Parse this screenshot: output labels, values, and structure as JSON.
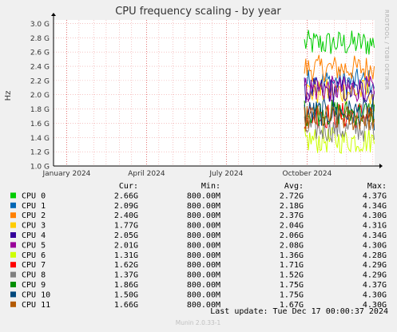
{
  "chart_data": {
    "type": "line",
    "title": "CPU frequency scaling - by year",
    "ylabel": "Hz",
    "watermark": "RRDTOOL / TOBI OETIKER",
    "ylim": [
      1.0,
      3.05
    ],
    "ytick_values": [
      1.0,
      1.2,
      1.4,
      1.6,
      1.8,
      2.0,
      2.2,
      2.4,
      2.6,
      2.8,
      3.0
    ],
    "ytick_labels": [
      "1.0 G",
      "1.2 G",
      "1.4 G",
      "1.6 G",
      "1.8 G",
      "2.0 G",
      "2.2 G",
      "2.4 G",
      "2.6 G",
      "2.8 G",
      "3.0 G"
    ],
    "xlim": [
      "2023-12-17",
      "2024-12-17"
    ],
    "xtick_labels": [
      "January 2024",
      "April 2024",
      "July 2024",
      "October 2024"
    ],
    "xtick_dates": [
      "2024-01-01",
      "2024-04-01",
      "2024-07-01",
      "2024-10-01"
    ],
    "data_start": "2024-09-28",
    "grid": true,
    "legend_header": {
      "cur": "Cur:",
      "min": "Min:",
      "avg": "Avg:",
      "max": "Max:"
    },
    "series": [
      {
        "name": "CPU 0",
        "color": "#00cc00",
        "cur": "2.66G",
        "min": "800.00M",
        "avg": "2.72G",
        "max": "4.37G"
      },
      {
        "name": "CPU 1",
        "color": "#0066b3",
        "cur": "2.09G",
        "min": "800.00M",
        "avg": "2.18G",
        "max": "4.34G"
      },
      {
        "name": "CPU 2",
        "color": "#ff8000",
        "cur": "2.40G",
        "min": "800.00M",
        "avg": "2.37G",
        "max": "4.30G"
      },
      {
        "name": "CPU 3",
        "color": "#ffcc00",
        "cur": "1.77G",
        "min": "800.00M",
        "avg": "2.04G",
        "max": "4.31G"
      },
      {
        "name": "CPU 4",
        "color": "#330099",
        "cur": "2.05G",
        "min": "800.00M",
        "avg": "2.06G",
        "max": "4.34G"
      },
      {
        "name": "CPU 5",
        "color": "#990099",
        "cur": "2.01G",
        "min": "800.00M",
        "avg": "2.08G",
        "max": "4.30G"
      },
      {
        "name": "CPU 6",
        "color": "#ccff00",
        "cur": "1.31G",
        "min": "800.00M",
        "avg": "1.36G",
        "max": "4.28G"
      },
      {
        "name": "CPU 7",
        "color": "#ff0000",
        "cur": "1.62G",
        "min": "800.00M",
        "avg": "1.71G",
        "max": "4.29G"
      },
      {
        "name": "CPU 8",
        "color": "#808080",
        "cur": "1.37G",
        "min": "800.00M",
        "avg": "1.52G",
        "max": "4.29G"
      },
      {
        "name": "CPU 9",
        "color": "#008f00",
        "cur": "1.86G",
        "min": "800.00M",
        "avg": "1.75G",
        "max": "4.37G"
      },
      {
        "name": "CPU 10",
        "color": "#00487d",
        "cur": "1.50G",
        "min": "800.00M",
        "avg": "1.75G",
        "max": "4.30G"
      },
      {
        "name": "CPU 11",
        "color": "#b35a00",
        "cur": "1.66G",
        "min": "800.00M",
        "avg": "1.67G",
        "max": "4.30G"
      }
    ],
    "last_update": "Last update:  Tue Dec 17 00:00:37 2024",
    "footer": "Munin 2.0.33-1"
  }
}
